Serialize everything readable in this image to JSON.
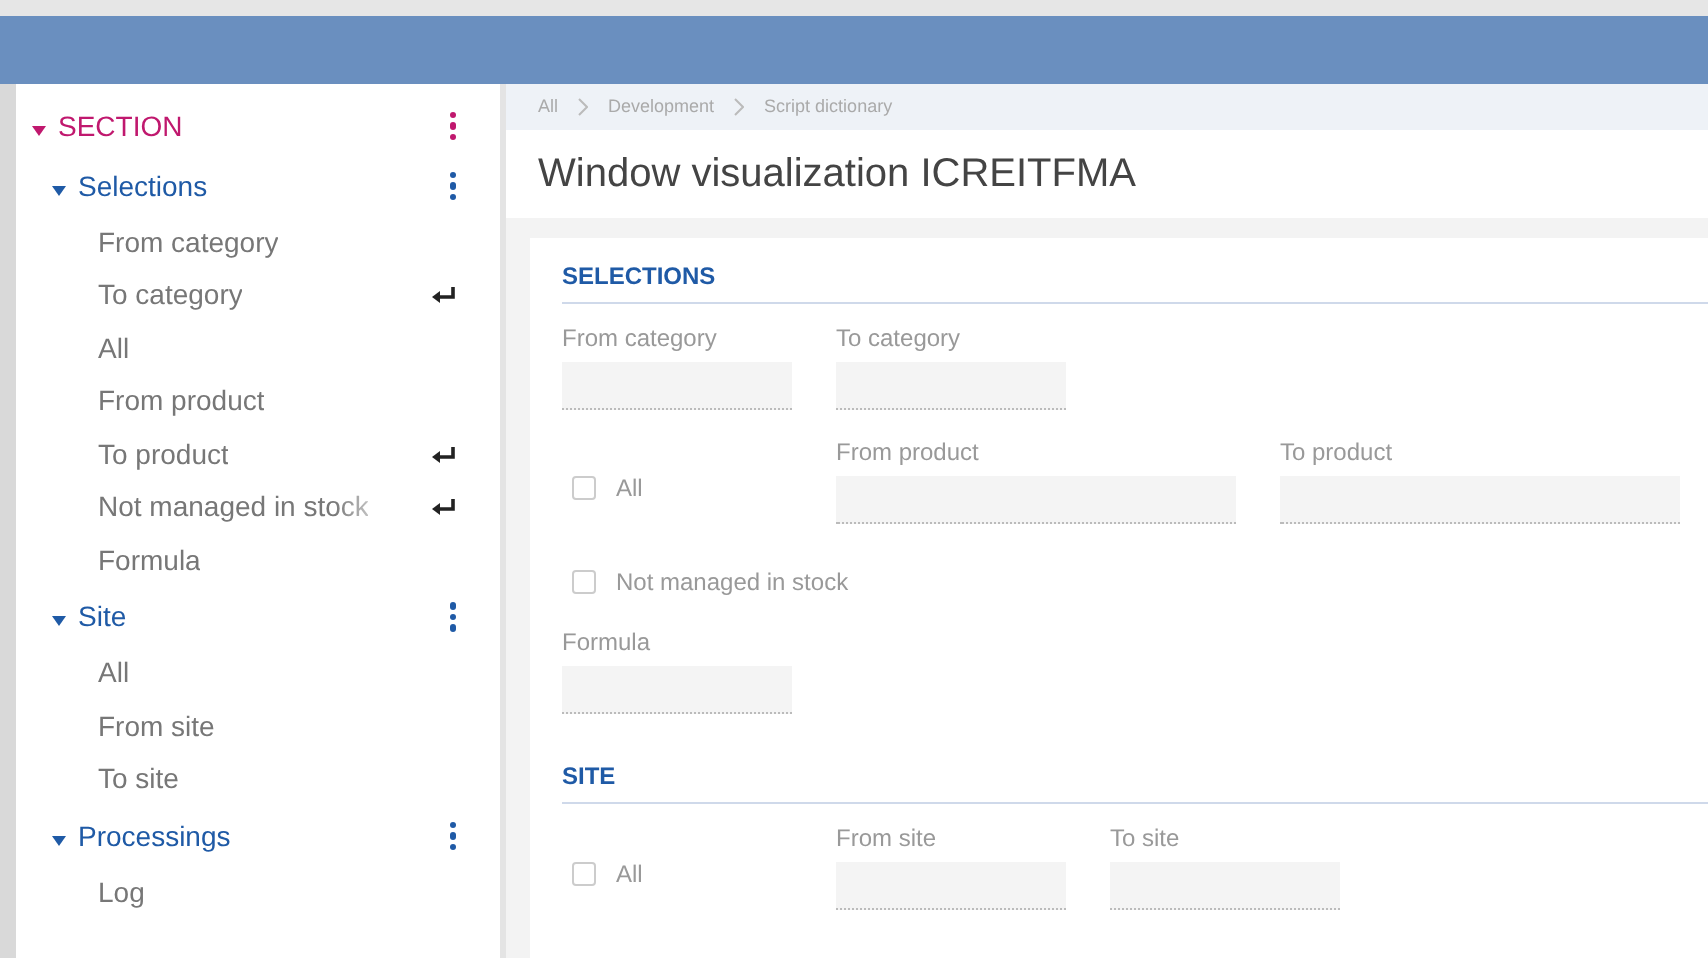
{
  "sidebar": {
    "section": {
      "label": "SECTION",
      "expanded": true
    },
    "groups": [
      {
        "label": "Selections",
        "expanded": true,
        "items": [
          {
            "label": "From category",
            "enter_mark": false
          },
          {
            "label": "To category",
            "enter_mark": true
          },
          {
            "label": "All",
            "enter_mark": false
          },
          {
            "label": "From product",
            "enter_mark": false
          },
          {
            "label": "To product",
            "enter_mark": true
          },
          {
            "label": "Not managed in stock",
            "enter_mark": true
          },
          {
            "label": "Formula",
            "enter_mark": false
          }
        ]
      },
      {
        "label": "Site",
        "expanded": true,
        "items": [
          {
            "label": "All",
            "enter_mark": false
          },
          {
            "label": "From site",
            "enter_mark": false
          },
          {
            "label": "To site",
            "enter_mark": false
          }
        ]
      },
      {
        "label": "Processings",
        "expanded": true,
        "items": [
          {
            "label": "Log",
            "enter_mark": false
          }
        ]
      }
    ]
  },
  "breadcrumb": [
    "All",
    "Development",
    "Script dictionary"
  ],
  "title": "Window visualization ICREITFMA",
  "sections": [
    {
      "title": "SELECTIONS",
      "rows": [
        [
          {
            "kind": "input",
            "label": "From category"
          },
          {
            "kind": "input",
            "label": "To category"
          }
        ],
        [
          {
            "kind": "checkbox",
            "label": "All",
            "checked": false
          },
          {
            "kind": "longinput",
            "label": "From product"
          },
          {
            "kind": "longinput",
            "label": "To product"
          }
        ],
        [
          {
            "kind": "checkbox",
            "label": "Not managed in stock",
            "checked": false
          }
        ],
        [
          {
            "kind": "input",
            "label": "Formula"
          }
        ]
      ]
    },
    {
      "title": "SITE",
      "rows": [
        [
          {
            "kind": "checkbox",
            "label": "All",
            "checked": false
          },
          {
            "kind": "input",
            "label": "From site"
          },
          {
            "kind": "input",
            "label": "To site"
          }
        ]
      ]
    }
  ]
}
